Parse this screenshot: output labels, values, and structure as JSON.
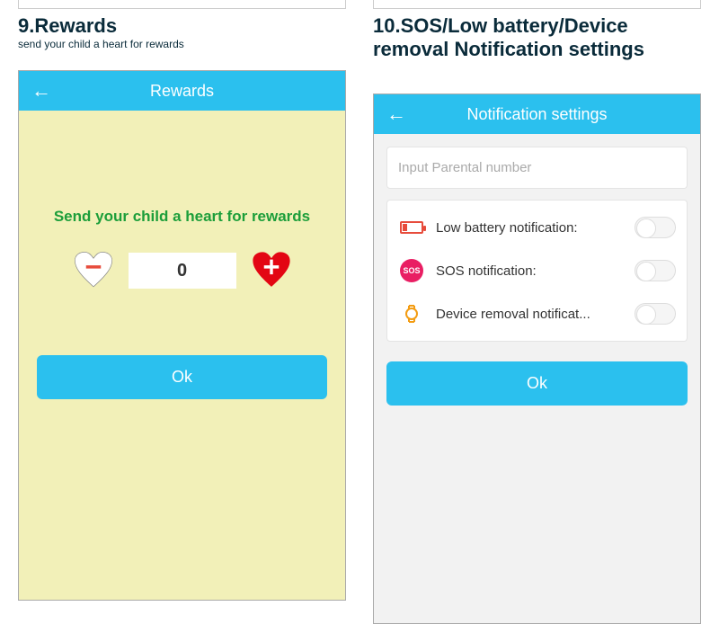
{
  "left": {
    "section_title": "9.Rewards",
    "section_sub": "send your child a heart for rewards",
    "appbar_title": "Rewards",
    "instruction": "Send your child a heart for rewards",
    "count": "0",
    "ok_label": "Ok"
  },
  "right": {
    "section_title": "10.SOS/Low battery/Device removal Notification settings",
    "appbar_title": "Notification settings",
    "input_placeholder": "Input Parental number",
    "settings": {
      "low_battery": "Low battery notification:",
      "sos": "SOS notification:",
      "device_removal": "Device removal notificat...",
      "sos_icon_text": "SOS"
    },
    "ok_label": "Ok"
  }
}
